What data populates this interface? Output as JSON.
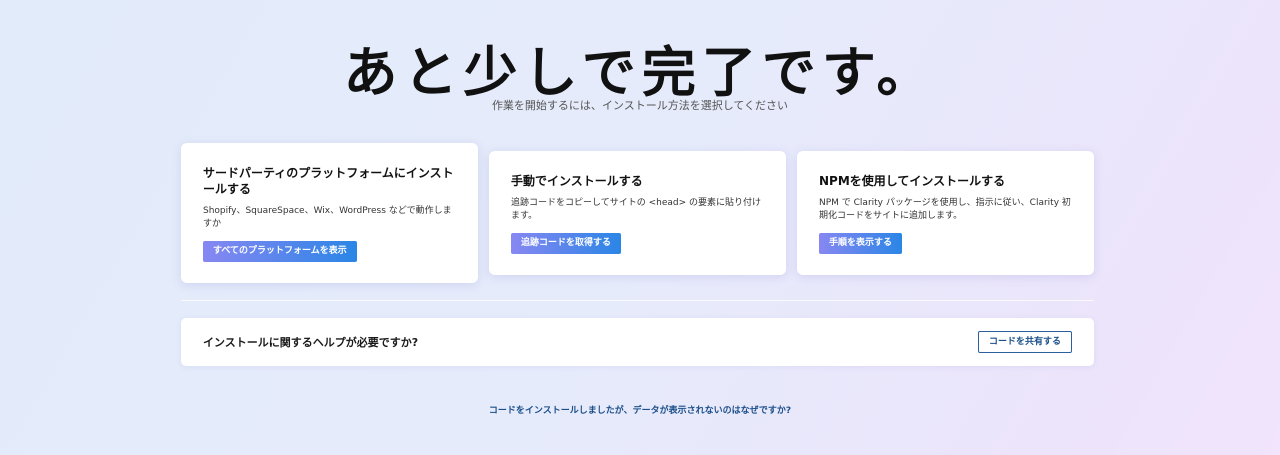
{
  "hero": {
    "title": "あと少しで完了です。",
    "subtitle": "作業を開始するには、インストール方法を選択してください"
  },
  "cards": [
    {
      "title": "サードパーティのプラットフォームにインストールする",
      "description": "Shopify、SquareSpace、Wix、WordPress などで動作しますか",
      "button": "すべてのプラットフォームを表示"
    },
    {
      "title": "手動でインストールする",
      "description": "追跡コードをコピーしてサイトの <head> の要素に貼り付けます。",
      "button": "追跡コードを取得する"
    },
    {
      "title": "NPMを使用してインストールする",
      "description": "NPM で Clarity パッケージを使用し、指示に従い、Clarity 初期化コードをサイトに追加します。",
      "button": "手順を表示する"
    }
  ],
  "help": {
    "text": "インストールに関するヘルプが必要ですか?",
    "button": "コードを共有する"
  },
  "footer": {
    "link": "コードをインストールしましたが、データが表示されないのはなぜですか?"
  },
  "colors": {
    "primary_gradient_start": "#8787f2",
    "primary_gradient_end": "#2a86e6",
    "link": "#1b4f8a"
  }
}
